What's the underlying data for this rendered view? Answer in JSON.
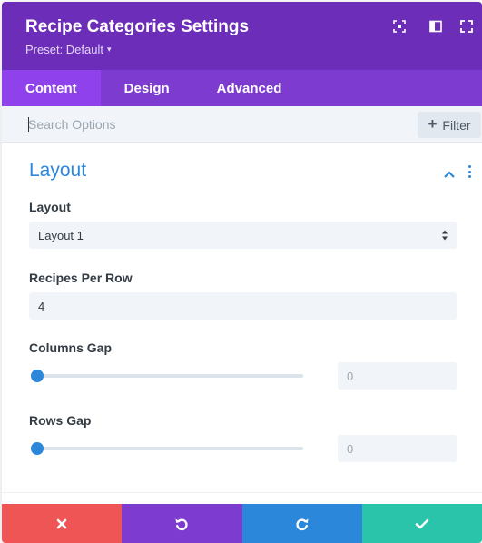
{
  "header": {
    "title": "Recipe Categories Settings",
    "preset_label": "Preset: Default",
    "bg_color": "#6c2eb9",
    "icons": [
      "target-icon",
      "sidebar-layout-icon",
      "expand-icon"
    ]
  },
  "tabs": [
    {
      "label": "Content",
      "active": true
    },
    {
      "label": "Design",
      "active": false
    },
    {
      "label": "Advanced",
      "active": false
    }
  ],
  "search": {
    "placeholder": "Search Options",
    "value": "",
    "filter_label": "Filter"
  },
  "section": {
    "title": "Layout",
    "accent_color": "#2b87da"
  },
  "fields": {
    "layout": {
      "label": "Layout",
      "value": "Layout 1"
    },
    "recipes_per_row": {
      "label": "Recipes Per Row",
      "value": "4"
    },
    "columns_gap": {
      "label": "Columns Gap",
      "value": "0",
      "slider_fraction": 0
    },
    "rows_gap": {
      "label": "Rows Gap",
      "value": "0",
      "slider_fraction": 0
    }
  },
  "footer": {
    "buttons": [
      {
        "name": "close",
        "icon": "close-icon",
        "color": "#ef5555"
      },
      {
        "name": "undo",
        "icon": "undo-icon",
        "color": "#7e3bd0"
      },
      {
        "name": "redo",
        "icon": "redo-icon",
        "color": "#2b87da"
      },
      {
        "name": "save",
        "icon": "check-icon",
        "color": "#29c4a9"
      }
    ]
  }
}
